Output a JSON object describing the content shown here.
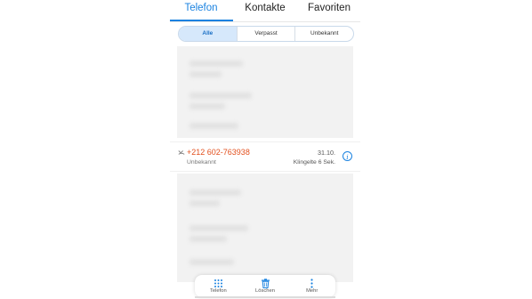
{
  "tabs": [
    {
      "label": "Telefon",
      "active": true
    },
    {
      "label": "Kontakte",
      "active": false
    },
    {
      "label": "Favoriten",
      "active": false
    }
  ],
  "filters": [
    {
      "label": "Alle",
      "active": true
    },
    {
      "label": "Verpasst",
      "active": false
    },
    {
      "label": "Unbekannt",
      "active": false
    }
  ],
  "call_log": [
    {
      "number": "+212 602-763938",
      "type": "Unbekannt",
      "date": "31.10.",
      "duration": "Klingelte 6 Sek.",
      "status_icon": "missed-call-icon",
      "color": "#e2501e"
    }
  ],
  "actions": [
    {
      "label": "Telefon",
      "icon": "dialpad-icon"
    },
    {
      "label": "Löschen",
      "icon": "trash-icon"
    },
    {
      "label": "Mehr",
      "icon": "more-vertical-icon"
    }
  ],
  "colors": {
    "accent": "#1a82e0",
    "missed": "#e2501e"
  }
}
